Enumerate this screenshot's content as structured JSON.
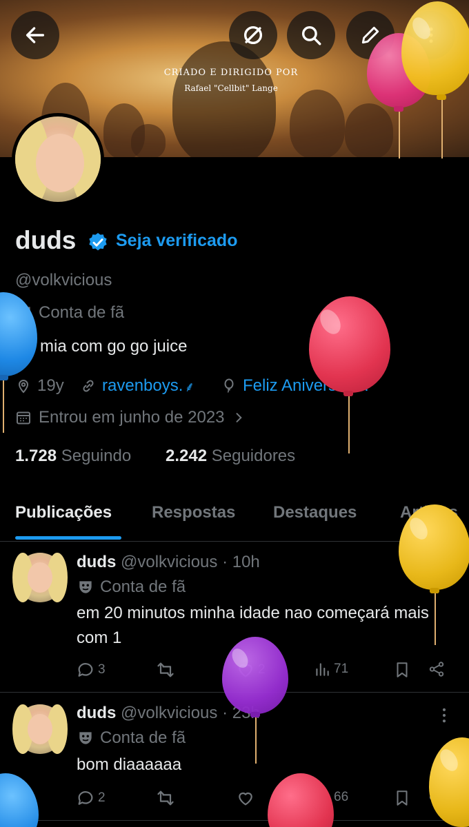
{
  "banner": {
    "credit_line1": "CRIADO E DIRIGIDO POR",
    "credit_line2": "Rafael \"Cellbit\" Lange"
  },
  "top_buttons": [
    "back-arrow-icon",
    "no-symbol-icon",
    "search-icon",
    "edit-icon"
  ],
  "profile": {
    "name": "duds",
    "verify_cta": "Seja verificado",
    "handle": "@volkvicious",
    "label": "Conta de fã",
    "bio": "mia com go go juice",
    "age": "19y",
    "link": "ravenboys.",
    "birthday": "Feliz Aniversário!",
    "joined": "Entrou em junho de 2023",
    "following_count": "1.728",
    "following_label": "Seguindo",
    "followers_count": "2.242",
    "followers_label": "Seguidores"
  },
  "tabs": [
    "Publicações",
    "Respostas",
    "Destaques",
    "Artigos"
  ],
  "posts": [
    {
      "name": "duds",
      "meta": "@volkvicious · 10h",
      "label": "Conta de fã",
      "text": "em 20 minutos minha idade nao começará mais com 1",
      "replies": "3",
      "likes": "2",
      "views": "71"
    },
    {
      "name": "duds",
      "meta": "@volkvicious · 23h",
      "label": "Conta de fã",
      "text": "bom diaaaaaa",
      "replies": "2",
      "likes": "",
      "views": "66"
    }
  ],
  "colors": {
    "accent": "#1d9bf0",
    "background": "#000000",
    "muted": "#71767b"
  }
}
